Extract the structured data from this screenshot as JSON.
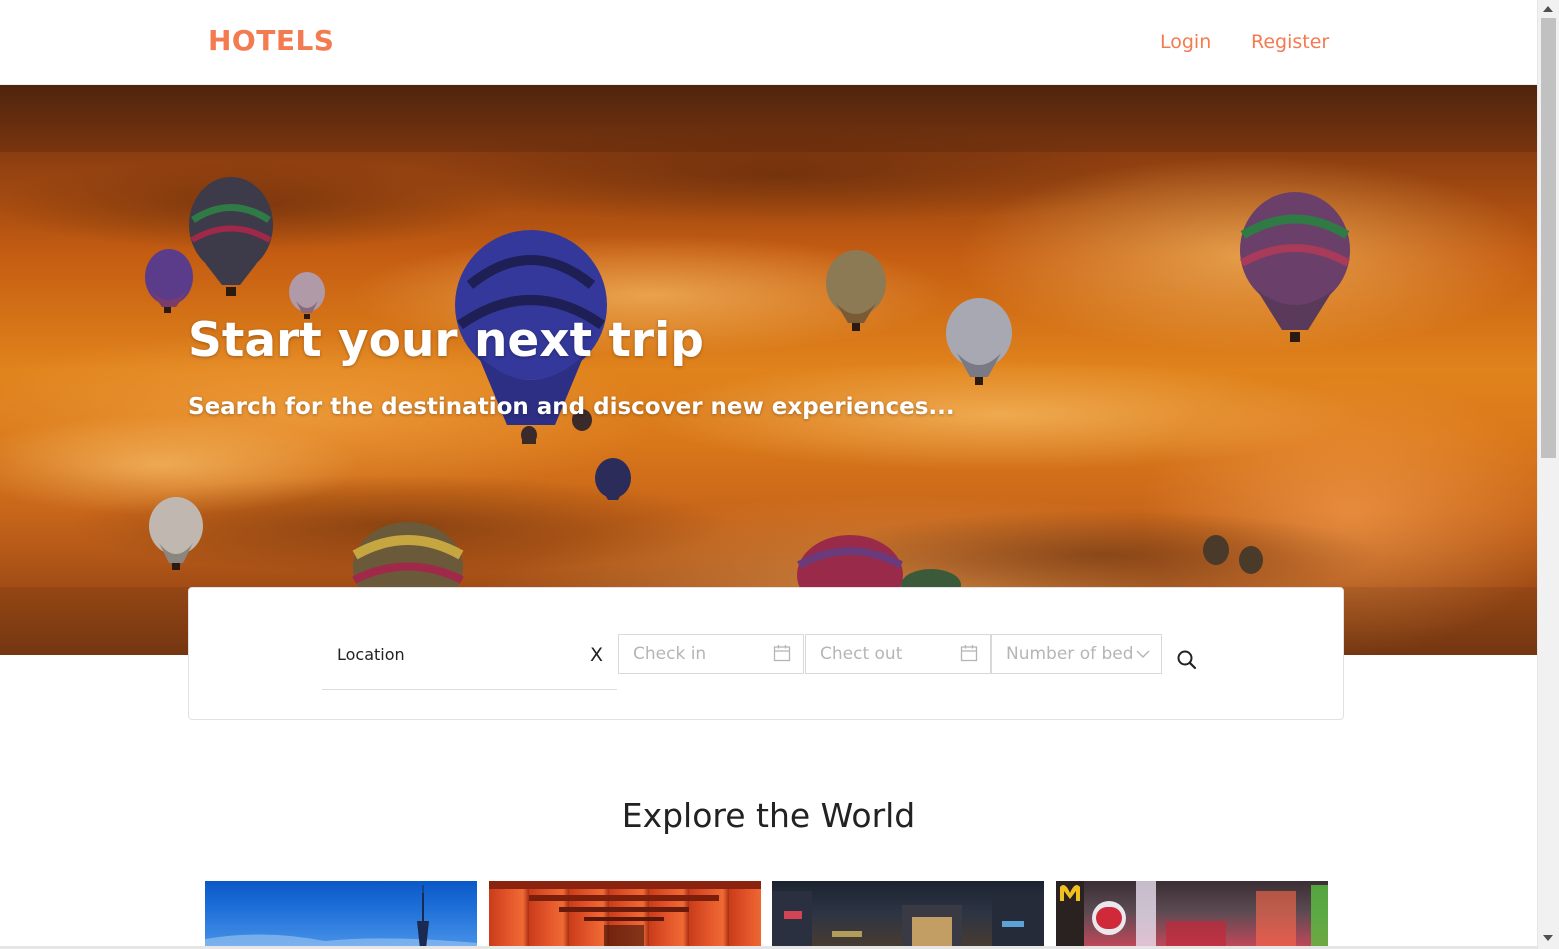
{
  "header": {
    "logo": "HOTELS",
    "nav": {
      "login": "Login",
      "register": "Register"
    },
    "brand_color": "#f47a4f"
  },
  "hero": {
    "title": "Start your next trip",
    "subtitle": "Search for the destination and discover new experiences..."
  },
  "search": {
    "location_value": "Location",
    "clear_label": "X",
    "check_in_placeholder": "Check in",
    "check_out_placeholder": "Chect out",
    "beds_placeholder": "Number of bed",
    "icons": {
      "calendar": "calendar-icon",
      "dropdown": "chevron-down-icon",
      "search": "search-icon"
    }
  },
  "explore": {
    "title": "Explore the World",
    "tiles": [
      "destination-tile-1",
      "destination-tile-2",
      "destination-tile-3",
      "destination-tile-4"
    ]
  }
}
